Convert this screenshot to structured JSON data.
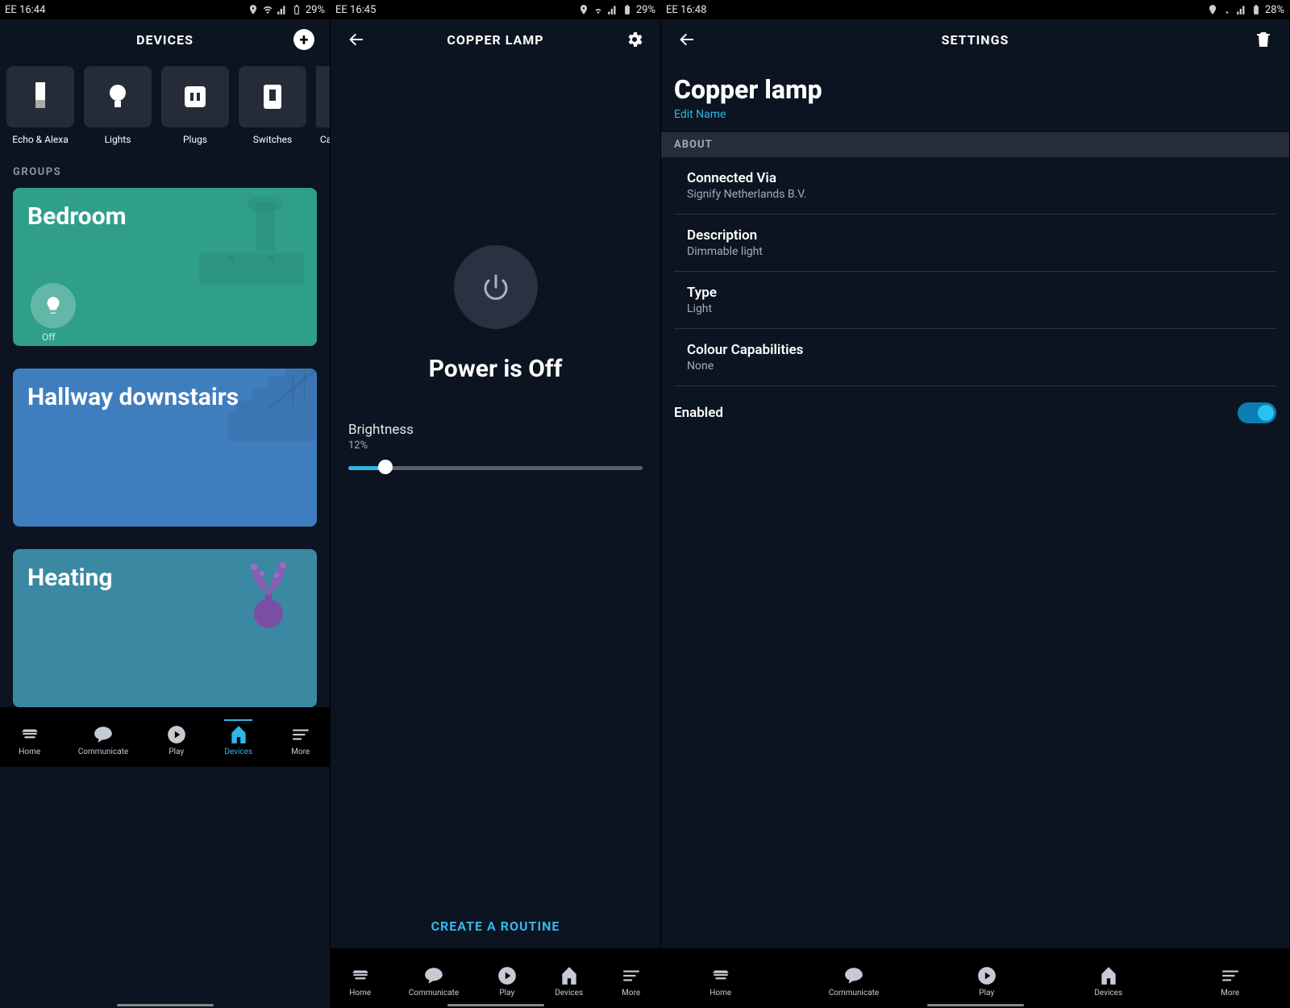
{
  "panel1": {
    "status": {
      "carrier": "EE",
      "time": "16:44",
      "battery": "29%"
    },
    "title": "DEVICES",
    "categories": [
      {
        "label": "Echo & Alexa"
      },
      {
        "label": "Lights"
      },
      {
        "label": "Plugs"
      },
      {
        "label": "Switches"
      },
      {
        "label": "Ca"
      }
    ],
    "groups_header": "GROUPS",
    "groups": [
      {
        "name": "Bedroom",
        "bulb_state": "Off"
      },
      {
        "name": "Hallway downstairs"
      },
      {
        "name": "Heating"
      }
    ]
  },
  "panel2": {
    "status": {
      "carrier": "EE",
      "time": "16:45",
      "battery": "29%"
    },
    "title": "COPPER LAMP",
    "power_status": "Power is Off",
    "brightness_label": "Brightness",
    "brightness_value": "12%",
    "create_routine": "CREATE A ROUTINE"
  },
  "panel3": {
    "status": {
      "carrier": "EE",
      "time": "16:48",
      "battery": "28%"
    },
    "title": "SETTINGS",
    "device_name": "Copper lamp",
    "edit_name": "Edit Name",
    "about_header": "ABOUT",
    "rows": [
      {
        "label": "Connected Via",
        "value": "Signify Netherlands B.V."
      },
      {
        "label": "Description",
        "value": "Dimmable light"
      },
      {
        "label": "Type",
        "value": "Light"
      },
      {
        "label": "Colour Capabilities",
        "value": "None"
      }
    ],
    "enabled_label": "Enabled"
  },
  "nav": {
    "items": [
      {
        "label": "Home"
      },
      {
        "label": "Communicate"
      },
      {
        "label": "Play"
      },
      {
        "label": "Devices"
      },
      {
        "label": "More"
      }
    ]
  },
  "colors": {
    "accent": "#2fb7e6"
  }
}
